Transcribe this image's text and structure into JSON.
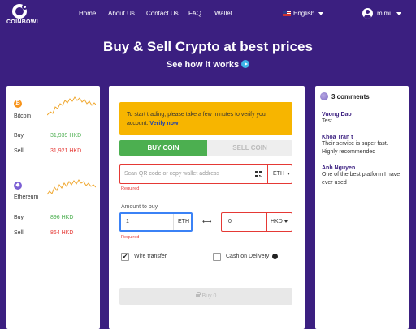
{
  "brand": {
    "name": "COINBOWL"
  },
  "nav": {
    "items": [
      "Home",
      "About Us",
      "Contact Us",
      "FAQ",
      "Wallet"
    ]
  },
  "language": {
    "label": "English"
  },
  "user": {
    "name": "mimi"
  },
  "hero": {
    "title": "Buy & Sell Crypto at best prices",
    "cta": "See how it works"
  },
  "prices": {
    "coins": [
      {
        "name": "Bitcoin",
        "symbol": "₿",
        "color": "#f7931a",
        "buy": "31,939 HKD",
        "sell": "31,921 HKD"
      },
      {
        "name": "Ethereum",
        "symbol": "◆",
        "color": "#7b5fd4",
        "buy": "896 HKD",
        "sell": "864 HKD"
      }
    ],
    "buy_label": "Buy",
    "sell_label": "Sell"
  },
  "trade": {
    "notice": "To start trading, please take a few minutes to verify your account.",
    "verify_link": "Verify now",
    "tab_buy": "BUY COIN",
    "tab_sell": "SELL COIN",
    "wallet_placeholder": "Scan QR code or copy wallet address",
    "wallet_currency": "ETH",
    "required": "Required",
    "amount_label": "Amount to buy",
    "amount_value": "1",
    "amount_unit": "ETH",
    "fiat_value": "0",
    "fiat_unit": "HKD",
    "wire_transfer": "Wire transfer",
    "cash_on_delivery": "Cash on Delivery",
    "buy_button": "Buy 0"
  },
  "comments": {
    "header": "3 comments",
    "items": [
      {
        "author": "Vuong Dao",
        "text": "Test"
      },
      {
        "author": "Khoa Tran t",
        "text": "Their service is super fast. Highly recommended"
      },
      {
        "author": "Anh Nguyen",
        "text": "One of the best platform I have ever used"
      }
    ]
  },
  "colors": {
    "background": "#3b1f80",
    "accent_green": "#4caf50",
    "accent_red": "#e53935",
    "notice": "#f7b500"
  }
}
